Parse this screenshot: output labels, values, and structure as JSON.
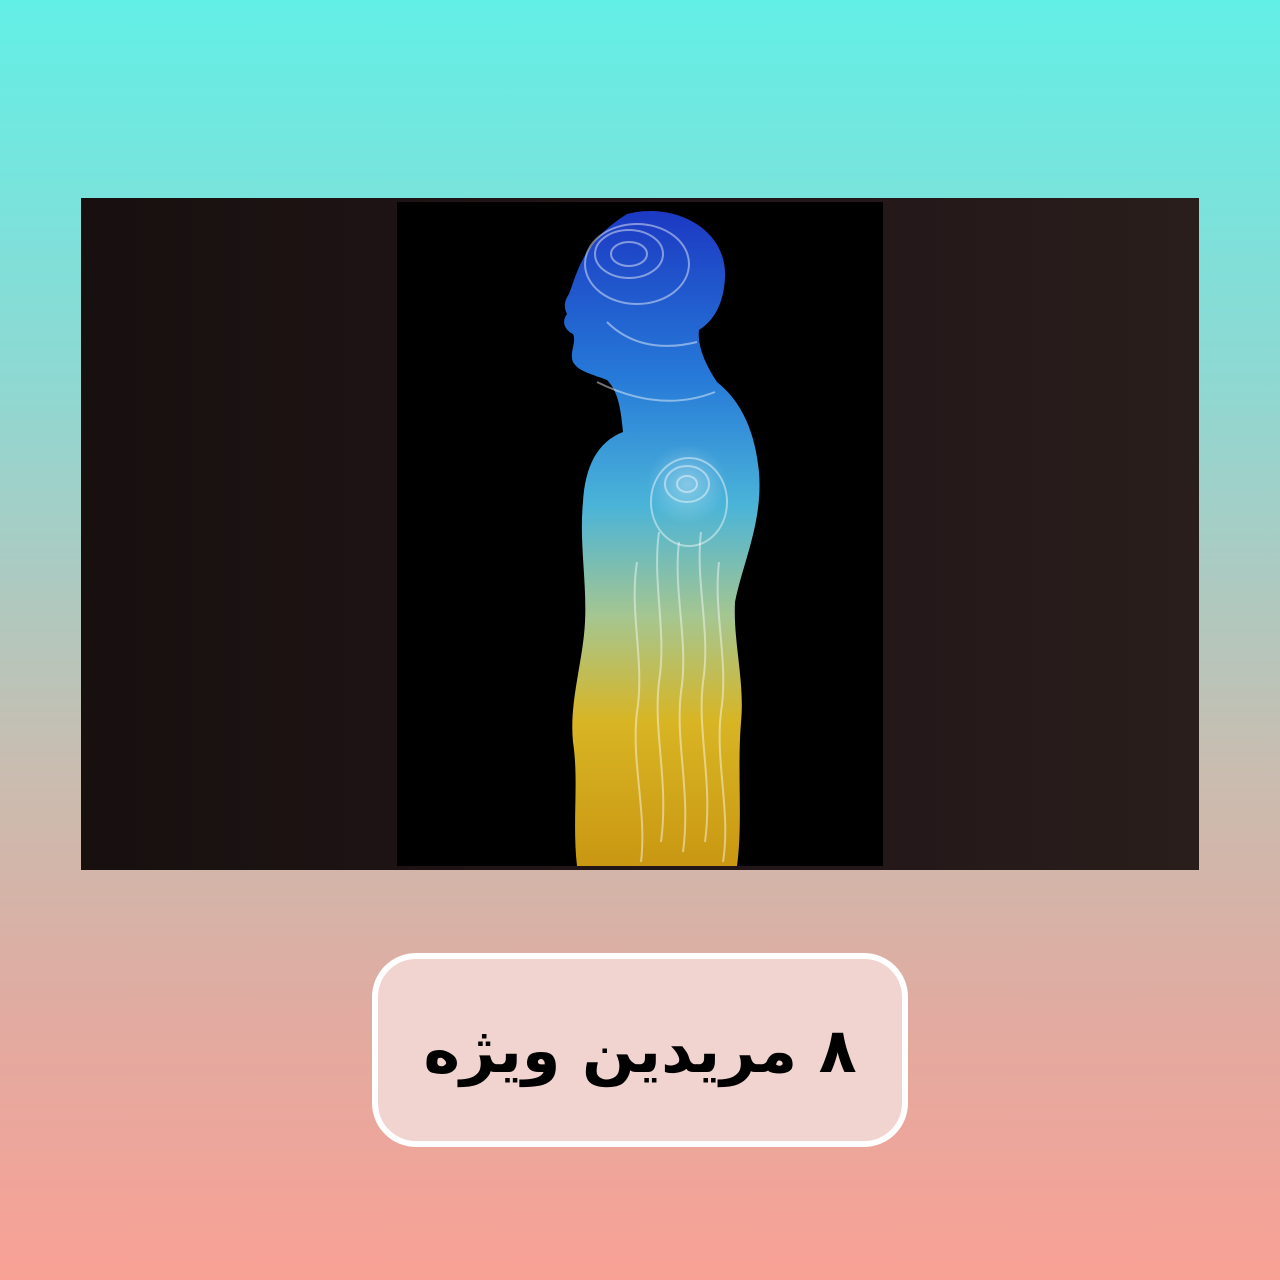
{
  "caption": {
    "text": "۸ مریدین ویژه"
  },
  "colors": {
    "bg_top": "#62efe6",
    "bg_bottom": "#f9a195",
    "banner": "#1f1415",
    "figure_top": "#1f4fe0",
    "figure_mid": "#4cc6ee",
    "figure_bottom": "#f1c21b",
    "caption_box": "#f1d4cf",
    "caption_border": "#ffffff"
  },
  "image": {
    "subject_icon": "human-energy-body-illustration"
  }
}
